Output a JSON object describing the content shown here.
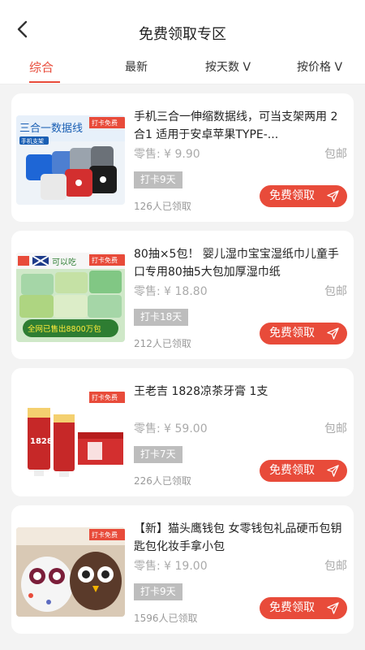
{
  "header": {
    "title": "免费领取专区",
    "back_icon": "chevron-left-icon"
  },
  "tabs": [
    {
      "label": "综合",
      "active": true
    },
    {
      "label": "最新",
      "active": false
    },
    {
      "label": "按天数 V",
      "active": false
    },
    {
      "label": "按价格 V",
      "active": false
    }
  ],
  "accent_color": "#e84b3a",
  "products": [
    {
      "title": "手机三合一伸缩数据线，可当支架两用 2合1  适用于安卓苹果TYPE-...",
      "price": "零售: ¥ 9.90",
      "shipping": "包邮",
      "days": "打卡9天",
      "claimed": "126人已领取",
      "button": "免费领取",
      "image_badge": "打卡免费",
      "image_text": "三合一数据线",
      "image_sub": "手机支架"
    },
    {
      "title": "80抽×5包！ 婴儿湿巾宝宝湿纸巾儿童手口专用80抽5大包加厚湿巾纸",
      "price": "零售: ¥ 18.80",
      "shipping": "包邮",
      "days": "打卡18天",
      "claimed": "212人已领取",
      "button": "免费领取",
      "image_badge": "打卡免费",
      "image_text": "可以吃",
      "image_sub": "全网已售出8800万包"
    },
    {
      "title": "王老吉 1828凉茶牙膏 1支",
      "price": "零售: ¥ 59.00",
      "shipping": "包邮",
      "days": "打卡7天",
      "claimed": "226人已领取",
      "button": "免费领取",
      "image_badge": "打卡免费",
      "image_text": "1828",
      "image_sub": ""
    },
    {
      "title": "【新】猫头鹰钱包 女零钱包礼品硬币包钥匙包化妆手拿小包",
      "price": "零售: ¥ 19.00",
      "shipping": "包邮",
      "days": "打卡9天",
      "claimed": "1596人已领取",
      "button": "免费领取",
      "image_badge": "打卡免费",
      "image_text": "",
      "image_sub": ""
    }
  ]
}
